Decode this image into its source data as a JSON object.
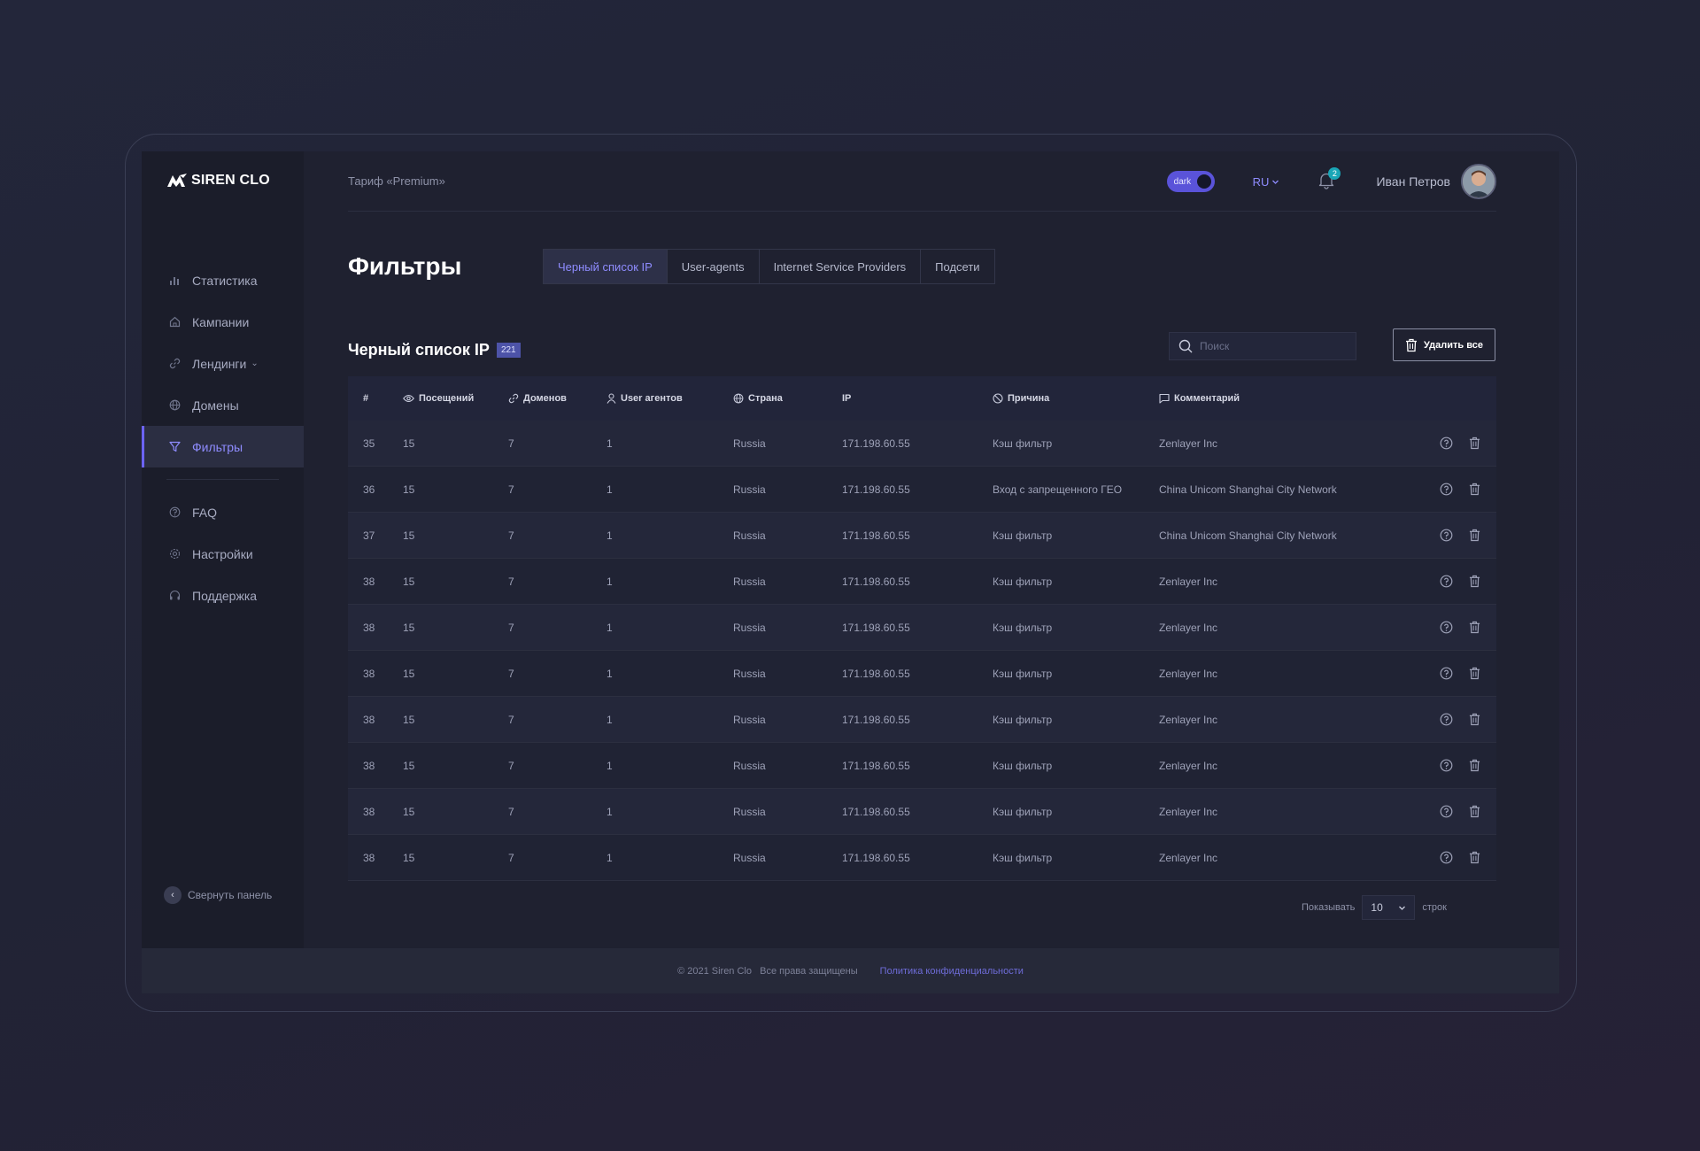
{
  "brand": {
    "name": "SIREN CLO"
  },
  "sidebar": {
    "items": [
      {
        "label": "Статистика",
        "icon": "bar-chart-icon"
      },
      {
        "label": "Кампании",
        "icon": "home-icon"
      },
      {
        "label": "Лендинги",
        "icon": "link-icon"
      },
      {
        "label": "Домены",
        "icon": "globe-icon"
      },
      {
        "label": "Фильтры",
        "icon": "filter-icon",
        "active": true
      }
    ],
    "secondary": [
      {
        "label": "FAQ",
        "icon": "question-icon"
      },
      {
        "label": "Настройки",
        "icon": "gear-icon"
      },
      {
        "label": "Поддержка",
        "icon": "headphones-icon"
      }
    ],
    "collapse_label": "Свернуть панель"
  },
  "topbar": {
    "tariff": "Тариф «Premium»",
    "theme_label": "dark",
    "language": "RU",
    "notifications_count": "2",
    "user_name": "Иван Петров"
  },
  "page": {
    "title": "Фильтры",
    "tabs": [
      {
        "label": "Черный список IP",
        "active": true
      },
      {
        "label": "User-agents"
      },
      {
        "label": "Internet Service Providers"
      },
      {
        "label": "Подсети"
      }
    ],
    "section_title": "Черный список IP",
    "section_count": "221",
    "search_placeholder": "Поиск",
    "delete_all_label": "Удалить все"
  },
  "table": {
    "columns": [
      "#",
      "Посещений",
      "Доменов",
      "User агентов",
      "Страна",
      "IP",
      "Причина",
      "Комментарий"
    ],
    "rows": [
      [
        "35",
        "15",
        "7",
        "1",
        "Russia",
        "171.198.60.55",
        "Кэш фильтр",
        "Zenlayer Inc"
      ],
      [
        "36",
        "15",
        "7",
        "1",
        "Russia",
        "171.198.60.55",
        "Вход с запрещенного ГЕО",
        "China Unicom Shanghai City Network"
      ],
      [
        "37",
        "15",
        "7",
        "1",
        "Russia",
        "171.198.60.55",
        "Кэш фильтр",
        "China Unicom Shanghai City Network"
      ],
      [
        "38",
        "15",
        "7",
        "1",
        "Russia",
        "171.198.60.55",
        "Кэш фильтр",
        "Zenlayer Inc"
      ],
      [
        "38",
        "15",
        "7",
        "1",
        "Russia",
        "171.198.60.55",
        "Кэш фильтр",
        "Zenlayer Inc"
      ],
      [
        "38",
        "15",
        "7",
        "1",
        "Russia",
        "171.198.60.55",
        "Кэш фильтр",
        "Zenlayer Inc"
      ],
      [
        "38",
        "15",
        "7",
        "1",
        "Russia",
        "171.198.60.55",
        "Кэш фильтр",
        "Zenlayer Inc"
      ],
      [
        "38",
        "15",
        "7",
        "1",
        "Russia",
        "171.198.60.55",
        "Кэш фильтр",
        "Zenlayer Inc"
      ],
      [
        "38",
        "15",
        "7",
        "1",
        "Russia",
        "171.198.60.55",
        "Кэш фильтр",
        "Zenlayer Inc"
      ],
      [
        "38",
        "15",
        "7",
        "1",
        "Russia",
        "171.198.60.55",
        "Кэш фильтр",
        "Zenlayer Inc"
      ]
    ]
  },
  "pagination": {
    "show_label": "Показывать",
    "per_page": "10",
    "rows_label": "строк"
  },
  "footer": {
    "copyright": "© 2021 Siren Clo",
    "rights": "Все права защищены",
    "privacy_link": "Политика конфиденциальности"
  },
  "colors": {
    "accent": "#6c63ff",
    "accent_text": "#8f8cff",
    "background": "#1f2130",
    "badge": "#1aa6b7"
  }
}
